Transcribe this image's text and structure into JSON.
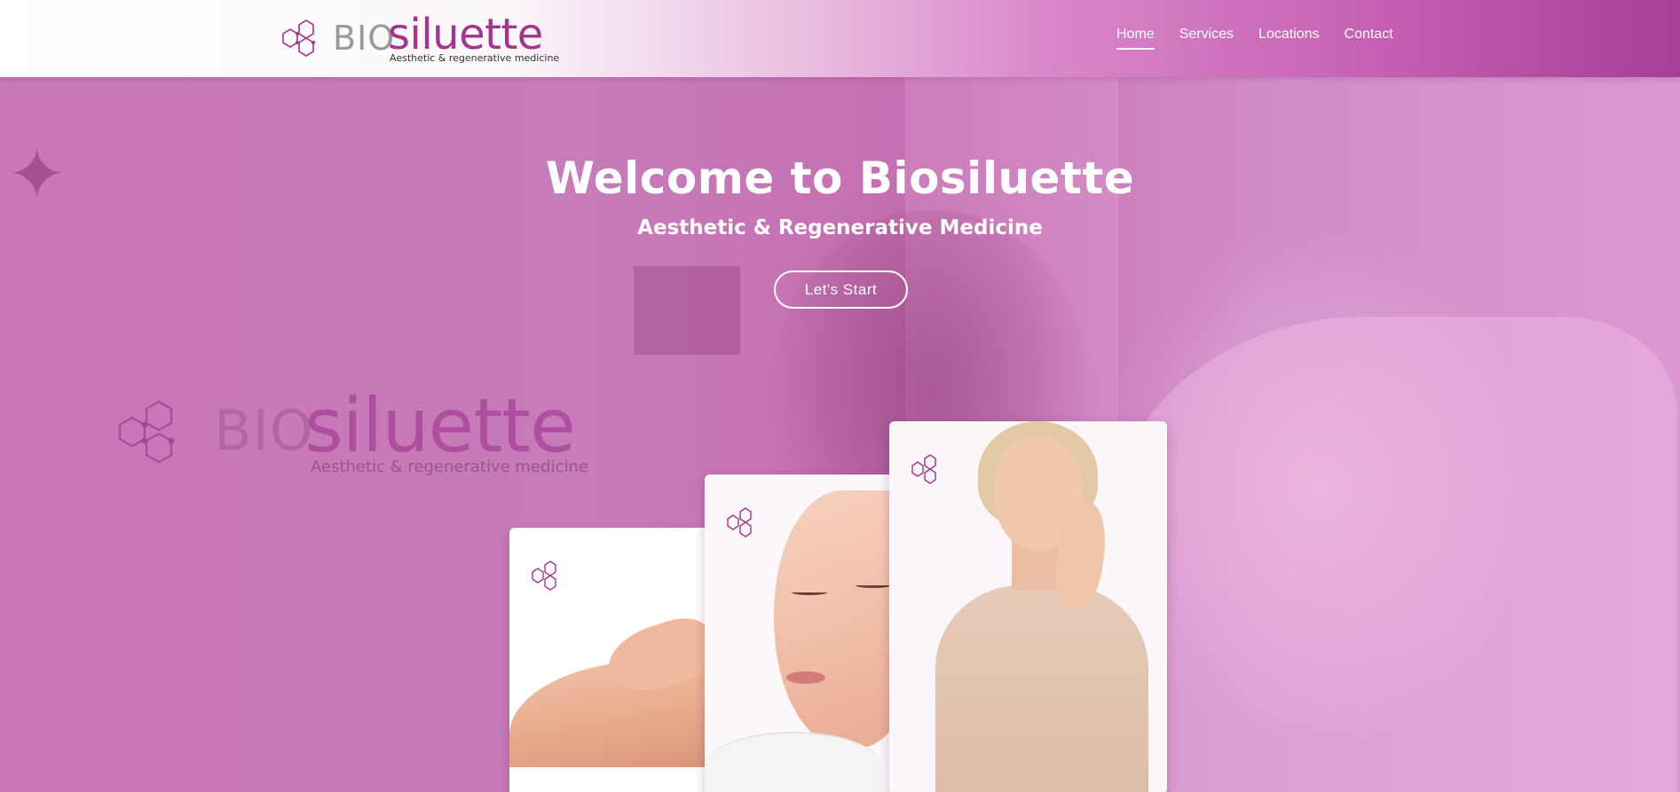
{
  "header": {
    "logo": {
      "bio": "BIO",
      "siluette": "siluette",
      "tagline": "Aesthetic & regenerative medicine"
    },
    "nav": [
      {
        "label": "Home",
        "active": true
      },
      {
        "label": "Services",
        "active": false
      },
      {
        "label": "Locations",
        "active": false
      },
      {
        "label": "Contact",
        "active": false
      }
    ]
  },
  "hero": {
    "title": "Welcome to Biosiluette",
    "subtitle": "Aesthetic & Regenerative Medicine",
    "cta_label": "Let's Start",
    "watermark": {
      "bio": "BIO",
      "siluette": "siluette",
      "tagline": "Aesthetic & regenerative medicine"
    },
    "cards": [
      {
        "name": "body-treatment",
        "icon": "hexagon-logo-icon"
      },
      {
        "name": "facial-lifting",
        "icon": "hexagon-logo-icon"
      },
      {
        "name": "skin-rejuvenation",
        "icon": "hexagon-logo-icon"
      }
    ]
  },
  "colors": {
    "brand": "#a3348f",
    "logo_gray": "#9a9a9a",
    "hero_overlay": "#c874b8",
    "white": "#ffffff"
  }
}
